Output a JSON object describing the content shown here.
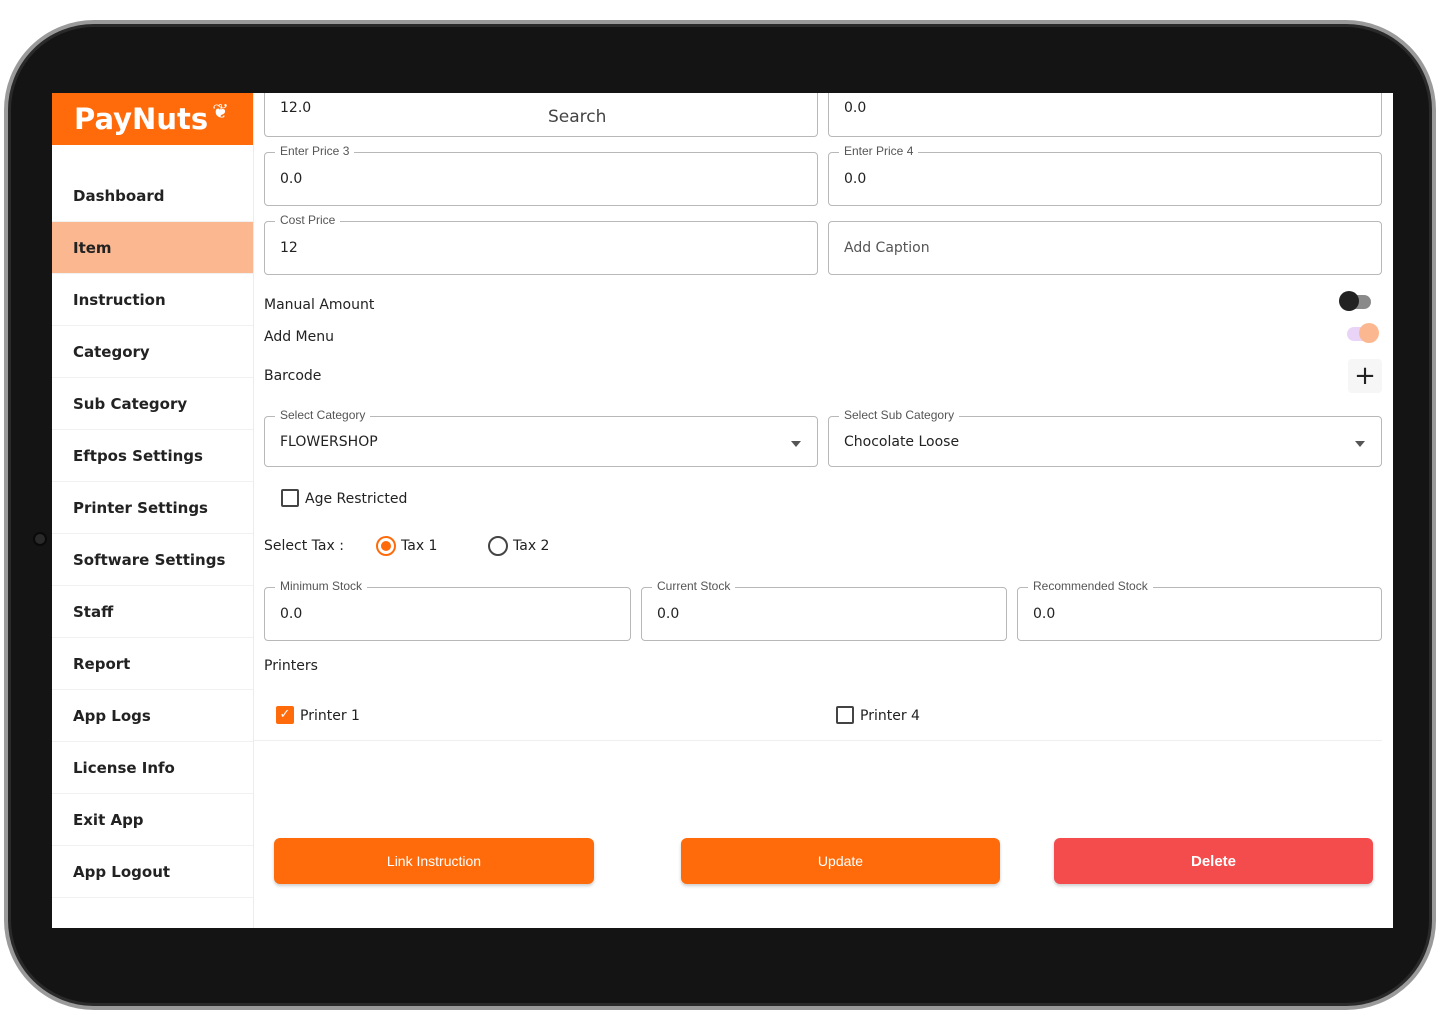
{
  "app": {
    "logo": "PayNuts"
  },
  "sidebar": {
    "items": [
      {
        "label": "Dashboard",
        "active": false
      },
      {
        "label": "Item",
        "active": true
      },
      {
        "label": "Instruction",
        "active": false
      },
      {
        "label": "Category",
        "active": false
      },
      {
        "label": "Sub Category",
        "active": false
      },
      {
        "label": "Eftpos Settings",
        "active": false
      },
      {
        "label": "Printer Settings",
        "active": false
      },
      {
        "label": "Software Settings",
        "active": false
      },
      {
        "label": "Staff",
        "active": false
      },
      {
        "label": "Report",
        "active": false
      },
      {
        "label": "App Logs",
        "active": false
      },
      {
        "label": "License Info",
        "active": false
      },
      {
        "label": "Exit App",
        "active": false
      },
      {
        "label": "App Logout",
        "active": false
      }
    ]
  },
  "form": {
    "price1_value": "12.0",
    "search_hint": "Search",
    "price2_value": "0.0",
    "price3": {
      "label": "Enter Price 3",
      "value": "0.0"
    },
    "price4": {
      "label": "Enter Price 4",
      "value": "0.0"
    },
    "cost_price": {
      "label": "Cost Price",
      "value": "12"
    },
    "caption_placeholder": "Add Caption",
    "manual_amount": {
      "label": "Manual Amount",
      "on": false
    },
    "add_menu": {
      "label": "Add Menu",
      "on": true
    },
    "barcode_label": "Barcode",
    "category": {
      "label": "Select Category",
      "value": "FLOWERSHOP"
    },
    "sub_category": {
      "label": "Select Sub Category",
      "value": "Chocolate Loose"
    },
    "age_restricted": {
      "label": "Age Restricted",
      "checked": false
    },
    "tax": {
      "label": "Select Tax :",
      "options": [
        "Tax 1",
        "Tax 2"
      ],
      "selected": "Tax 1"
    },
    "min_stock": {
      "label": "Minimum Stock",
      "value": "0.0"
    },
    "current_stock": {
      "label": "Current Stock",
      "value": "0.0"
    },
    "recommended_stock": {
      "label": "Recommended Stock",
      "value": "0.0"
    },
    "printers_label": "Printers",
    "printers": [
      {
        "label": "Printer 1",
        "checked": true
      },
      {
        "label": "Printer 4",
        "checked": false
      }
    ]
  },
  "actions": {
    "link_instruction": "Link Instruction",
    "update": "Update",
    "delete": "Delete"
  },
  "colors": {
    "accent": "#ff6b0a",
    "active_nav": "#fbb890",
    "delete": "#f44c4c"
  }
}
